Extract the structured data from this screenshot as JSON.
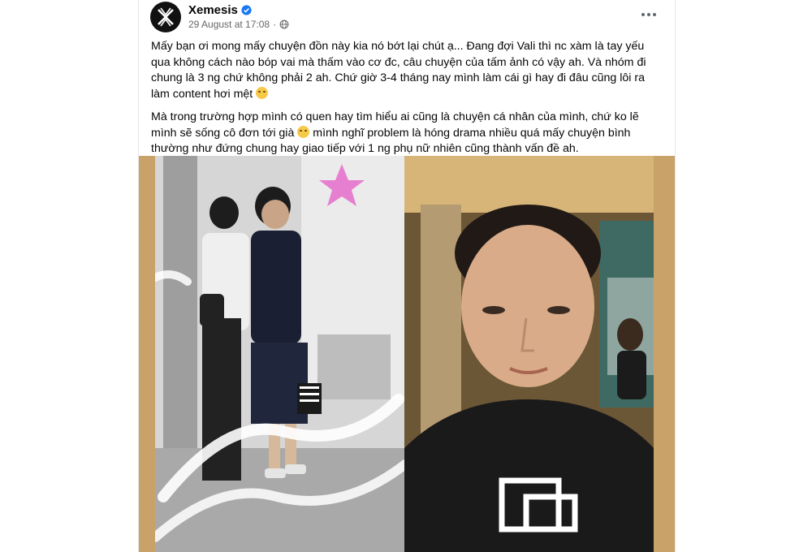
{
  "post": {
    "author": "Xemesis",
    "timestamp": "29 August at 17:08",
    "separator": "·",
    "icons": {
      "verified": "verified-badge-icon",
      "audience": "globe-icon",
      "more": "more-options-icon",
      "avatar_logo": "xemesis-logo"
    },
    "paragraph1": "Mấy bạn ơi mong mấy chuyện đồn này kia nó bớt lại chút ạ... Đang đợi Vali thì nc xàm là tay yếu qua không cách nào bóp vai mà thấm vào cơ đc, câu chuyện của tấm ảnh có vậy ah. Và nhóm đi chung là 3 ng chứ không phải 2 ah. Chứ giờ 3-4 tháng nay mình làm cái gì hay đi đâu cũng lôi ra làm content hơi mệt",
    "paragraph2a": "Mà trong trường hợp mình có quen hay tìm hiểu ai cũng là chuyện cá nhân của mình, chứ ko lẽ mình sẽ sống cô đơn tới già",
    "paragraph2b": "mình nghĩ problem là hóng drama nhiều quá mấy chuyện bình thường như đứng chung hay giao tiếp với 1 ng phụ nữ nhiên cũng thành vấn đề ah.",
    "emoji1": "rolling-eyes-emoji",
    "emoji2": "thinking-emoji",
    "brand_color": "#1877f2"
  },
  "photo": {
    "left_image": "airport-photo",
    "right_image": "selfie-photo"
  }
}
